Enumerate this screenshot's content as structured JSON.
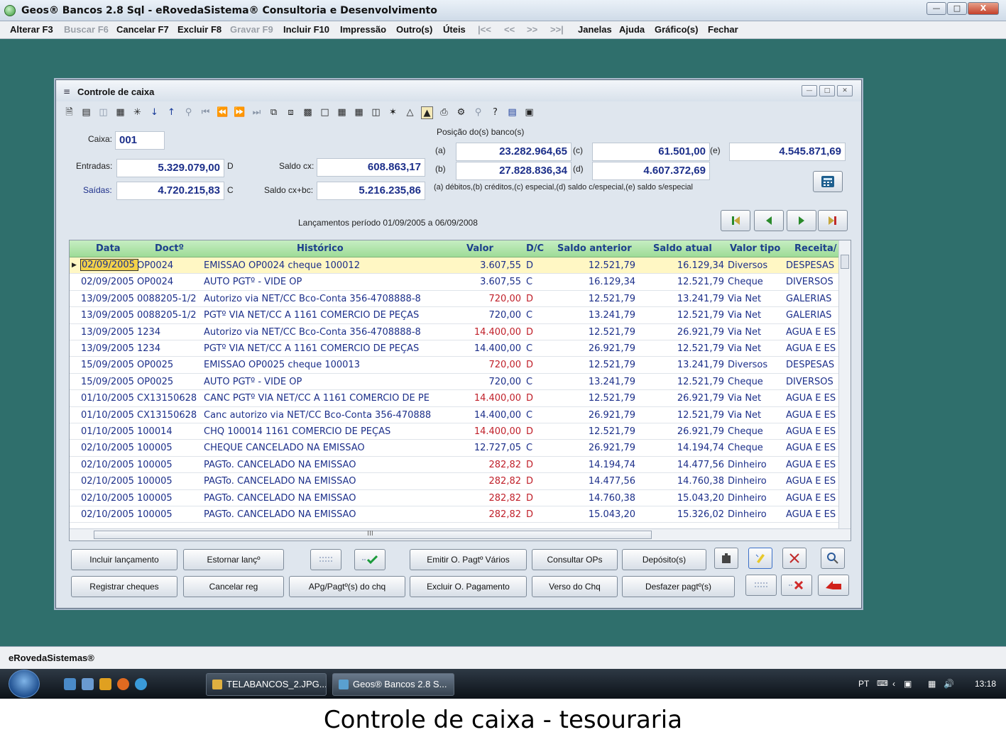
{
  "window": {
    "title": "Geos® Bancos 2.8 Sql - eRovedaSistema® Consultoria e Desenvolvimento"
  },
  "menu": {
    "alterar": "Alterar F3",
    "buscar": "Buscar F6",
    "cancelar": "Cancelar F7",
    "excluir": "Excluir F8",
    "gravar": "Gravar F9",
    "incluir": "Incluir F10",
    "impressao": "Impressão",
    "outros": "Outro(s)",
    "uteis": "Úteis",
    "first": "|<<",
    "prev": "<<",
    "next": ">>",
    "last": ">>|",
    "janelas": "Janelas",
    "ajuda": "Ajuda",
    "grafico": "Gráfico(s)",
    "fechar": "Fechar"
  },
  "child": {
    "title": "Controle de caixa"
  },
  "form": {
    "caixa_label": "Caixa:",
    "caixa_value": "001",
    "entradas_label": "Entradas:",
    "entradas_value": "5.329.079,00",
    "entradas_suffix": "D",
    "saidas_label": "Saídas:",
    "saidas_value": "4.720.215,83",
    "saidas_suffix": "C",
    "saldo_cx_label": "Saldo cx:",
    "saldo_cx_value": "608.863,17",
    "saldo_cxbc_label": "Saldo cx+bc:",
    "saldo_cxbc_value": "5.216.235,86",
    "posicao_label": "Posição do(s) banco(s)",
    "a_label": "(a)",
    "a_value": "23.282.964,65",
    "b_label": "(b)",
    "b_value": "27.828.836,34",
    "c_label": "(c)",
    "c_value": "61.501,00",
    "d_label": "(d)",
    "d_value": "4.607.372,69",
    "e_label": "(e)",
    "e_value": "4.545.871,69",
    "legenda": "(a) débitos,(b) créditos,(c) especial,(d) saldo c/especial,(e) saldo s/especial",
    "periodo": "Lançamentos período 01/09/2005 a 06/09/2008"
  },
  "grid": {
    "headers": [
      "Data",
      "Doctº",
      "Histórico",
      "Valor",
      "D/C",
      "Saldo anterior",
      "Saldo atual",
      "Valor tipo",
      "Receita/"
    ],
    "rows": [
      [
        "02/09/2005",
        "OP0024",
        "EMISSÃO OP0024 cheque 100012",
        "3.607,55",
        "D",
        "12.521,79",
        "16.129,34",
        "Diversos",
        "DESPESAS"
      ],
      [
        "02/09/2005",
        "OP0024",
        "AUTO PGTº - VIDE OP",
        "3.607,55",
        "C",
        "16.129,34",
        "12.521,79",
        "Cheque",
        "DIVERSOS"
      ],
      [
        "13/09/2005",
        "0088205-1/2",
        "Autorizo via NET/CC Bco-Conta 356-4708888-8",
        "720,00",
        "D",
        "12.521,79",
        "13.241,79",
        "Via Net",
        "GALERIAS"
      ],
      [
        "13/09/2005",
        "0088205-1/2",
        "PGTº VIA NET/CC A 1161 COMERCIO DE PEÇAS",
        "720,00",
        "C",
        "13.241,79",
        "12.521,79",
        "Via Net",
        "GALERIAS"
      ],
      [
        "13/09/2005",
        "1234",
        "Autorizo via NET/CC Bco-Conta 356-4708888-8",
        "14.400,00",
        "D",
        "12.521,79",
        "26.921,79",
        "Via Net",
        "ÁGUA E ES"
      ],
      [
        "13/09/2005",
        "1234",
        "PGTº VIA NET/CC A 1161 COMERCIO DE PEÇAS",
        "14.400,00",
        "C",
        "26.921,79",
        "12.521,79",
        "Via Net",
        "ÁGUA E ES"
      ],
      [
        "15/09/2005",
        "OP0025",
        "EMISSÃO OP0025 cheque 100013",
        "720,00",
        "D",
        "12.521,79",
        "13.241,79",
        "Diversos",
        "DESPESAS"
      ],
      [
        "15/09/2005",
        "OP0025",
        "AUTO PGTº - VIDE OP",
        "720,00",
        "C",
        "13.241,79",
        "12.521,79",
        "Cheque",
        "DIVERSOS"
      ],
      [
        "01/10/2005",
        "CX13150628",
        "CANC PGTº VIA NET/CC A 1161 COMERCIO DE PE",
        "14.400,00",
        "D",
        "12.521,79",
        "26.921,79",
        "Via Net",
        "ÁGUA E ES"
      ],
      [
        "01/10/2005",
        "CX13150628",
        "Canc autorizo via NET/CC Bco-Conta 356-470888",
        "14.400,00",
        "C",
        "26.921,79",
        "12.521,79",
        "Via Net",
        "ÁGUA E ES"
      ],
      [
        "01/10/2005",
        "100014",
        "CHQ 100014 1161 COMERCIO DE PEÇAS",
        "14.400,00",
        "D",
        "12.521,79",
        "26.921,79",
        "Cheque",
        "ÁGUA E ES"
      ],
      [
        "02/10/2005",
        "100005",
        "CHEQUE CANCELADO NA EMISSÃO",
        "12.727,05",
        "C",
        "26.921,79",
        "14.194,74",
        "Cheque",
        "ÁGUA E ES"
      ],
      [
        "02/10/2005",
        "100005",
        "PAGTo. CANCELADO NA EMISSÃO",
        "282,82",
        "D",
        "14.194,74",
        "14.477,56",
        "Dinheiro",
        "ÁGUA E ES"
      ],
      [
        "02/10/2005",
        "100005",
        "PAGTo. CANCELADO NA EMISSÃO",
        "282,82",
        "D",
        "14.477,56",
        "14.760,38",
        "Dinheiro",
        "ÁGUA E ES"
      ],
      [
        "02/10/2005",
        "100005",
        "PAGTo. CANCELADO NA EMISSÃO",
        "282,82",
        "D",
        "14.760,38",
        "15.043,20",
        "Dinheiro",
        "ÁGUA E ES"
      ],
      [
        "02/10/2005",
        "100005",
        "PAGTo. CANCELADO NA EMISSÃO",
        "282,82",
        "D",
        "15.043,20",
        "15.326,02",
        "Dinheiro",
        "ÁGUA E ES"
      ]
    ],
    "hscroll_mark": "III"
  },
  "buttons": {
    "incluir_lanc": "Incluir lançamento",
    "estornar": "Estornar lançº",
    "emitir_op": "Emitir O. Pagtº Vários",
    "consultar_ops": "Consultar OPs",
    "deposito": "Depósito(s)",
    "registrar": "Registrar cheques",
    "cancelar_reg": "Cancelar reg",
    "apg": "APg/Pagtº(s) do chq",
    "excluir_op": "Excluir O. Pagamento",
    "verso": "Verso do Chq",
    "desfazer": "Desfazer pagtº(s)"
  },
  "statusbar": {
    "text": "eRovedaSistemas®"
  },
  "taskbar": {
    "task1": "TELABANCOS_2.JPG...",
    "task2": "Geos® Bancos 2.8 S...",
    "lang": "PT",
    "clock": "13:18"
  },
  "caption": "Controle de caixa - tesouraria",
  "colors": {
    "desktop": "#2f6f6c",
    "grid_header": "#9edb97",
    "text_blue": "#1c2f8a",
    "text_red": "#c0202a",
    "current_row": "#fff7c4"
  }
}
